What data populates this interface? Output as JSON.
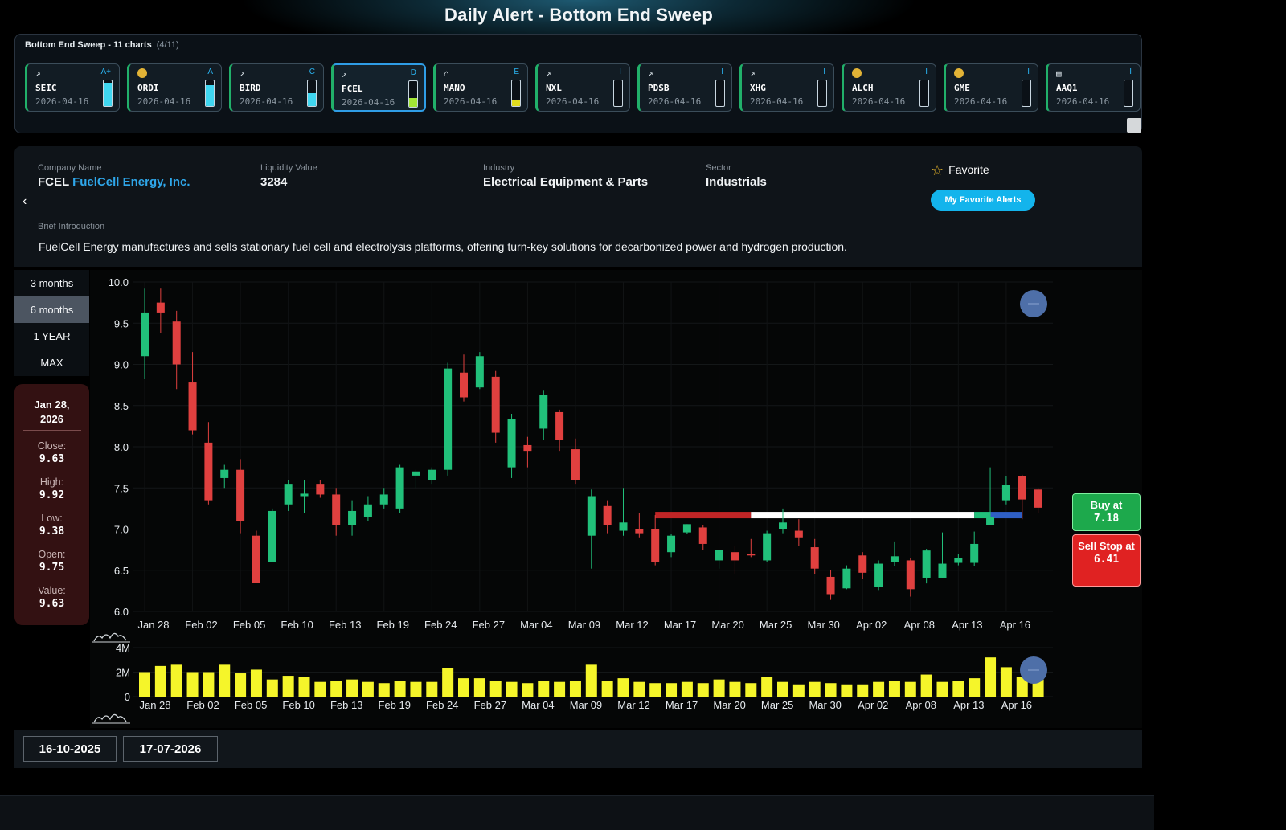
{
  "page": {
    "title": "Daily Alert - Bottom End Sweep"
  },
  "carousel": {
    "title": "Bottom End Sweep - 11 charts",
    "count": "(4/11)",
    "items": [
      {
        "symbol": "SEIC",
        "date": "2026-04-16",
        "grade": "A+",
        "icon": "chart-icon",
        "level": 0.9,
        "fill_color": "#3fd6f0",
        "active": false
      },
      {
        "symbol": "ORDI",
        "date": "2026-04-16",
        "grade": "A",
        "icon": "coin-icon",
        "level": 0.8,
        "fill_color": "#3fd6f0",
        "active": false
      },
      {
        "symbol": "BIRD",
        "date": "2026-04-16",
        "grade": "C",
        "icon": "chart-icon",
        "level": 0.5,
        "fill_color": "#3fd6f0",
        "active": false
      },
      {
        "symbol": "FCEL",
        "date": "2026-04-16",
        "grade": "D",
        "icon": "chart-icon",
        "level": 0.35,
        "fill_color": "#a3e635",
        "active": true
      },
      {
        "symbol": "MANO",
        "date": "2026-04-16",
        "grade": "E",
        "icon": "bank-icon",
        "level": 0.25,
        "fill_color": "#e0dc1e",
        "active": false
      },
      {
        "symbol": "NXL",
        "date": "2026-04-16",
        "grade": "I",
        "icon": "chart-icon",
        "level": 0.0,
        "fill_color": "#3fd6f0",
        "active": false
      },
      {
        "symbol": "PDSB",
        "date": "2026-04-16",
        "grade": "I",
        "icon": "chart-icon",
        "level": 0.0,
        "fill_color": "#3fd6f0",
        "active": false
      },
      {
        "symbol": "XHG",
        "date": "2026-04-16",
        "grade": "I",
        "icon": "chart-icon",
        "level": 0.0,
        "fill_color": "#3fd6f0",
        "active": false
      },
      {
        "symbol": "ALCH",
        "date": "2026-04-16",
        "grade": "I",
        "icon": "coin-icon",
        "level": 0.0,
        "fill_color": "#3fd6f0",
        "active": false
      },
      {
        "symbol": "GME",
        "date": "2026-04-16",
        "grade": "I",
        "icon": "coin-icon",
        "level": 0.0,
        "fill_color": "#3fd6f0",
        "active": false
      },
      {
        "symbol": "AAQ1",
        "date": "2026-04-16",
        "grade": "I",
        "icon": "etf-icon",
        "level": 0.0,
        "fill_color": "#3fd6f0",
        "active": false
      }
    ]
  },
  "info": {
    "company_label": "Company Name",
    "ticker": "FCEL",
    "company_name": "FuelCell Energy, Inc.",
    "liquidity_label": "Liquidity Value",
    "liquidity": "3284",
    "industry_label": "Industry",
    "industry": "Electrical Equipment & Parts",
    "sector_label": "Sector",
    "sector": "Industrials",
    "favorite_label": "Favorite",
    "favorite_alerts_button": "My Favorite Alerts",
    "intro_label": "Brief Introduction",
    "intro": "FuelCell Energy manufactures and sells stationary fuel cell and electrolysis platforms, offering turn-key solutions for decarbonized power and hydrogen production."
  },
  "ranges": [
    "3 months",
    "6 months",
    "1 YEAR",
    "MAX"
  ],
  "active_range": "6 months",
  "ohlc": {
    "date": "Jan 28, 2026",
    "close_label": "Close:",
    "close": "9.63",
    "high_label": "High:",
    "high": "9.92",
    "low_label": "Low:",
    "low": "9.38",
    "open_label": "Open:",
    "open": "9.75",
    "value_label": "Value:",
    "value": "9.63"
  },
  "signals": {
    "buy_label": "Buy at",
    "buy_value": "7.18",
    "sell_label": "Sell Stop at",
    "sell_value": "6.41"
  },
  "date_range": {
    "start": "16-10-2025",
    "end": "17-07-2026"
  },
  "colors": {
    "up": "#21c07a",
    "down": "#e0403f",
    "volume": "#f5f52a",
    "zone_red": "#c02526",
    "zone_white": "#ffffff",
    "zone_blue": "#2f5fc4",
    "accent": "#13b4ec"
  },
  "chart_data": {
    "type": "candlestick",
    "ylim": [
      6.0,
      10.0
    ],
    "y_ticks": [
      "10.0",
      "9.5",
      "9.0",
      "8.5",
      "8.0",
      "7.5",
      "7.0",
      "6.5",
      "6.0"
    ],
    "x_tick_labels": [
      "Jan 28",
      "Feb 02",
      "Feb 05",
      "Feb 10",
      "Feb 13",
      "Feb 19",
      "Feb 24",
      "Feb 27",
      "Mar 04",
      "Mar 09",
      "Mar 12",
      "Mar 17",
      "Mar 20",
      "Mar 25",
      "Mar 30",
      "Apr 02",
      "Apr 08",
      "Apr 13",
      "Apr 16"
    ],
    "candles": [
      {
        "o": 9.1,
        "c": 9.63,
        "h": 9.92,
        "l": 8.82
      },
      {
        "o": 9.75,
        "c": 9.63,
        "h": 9.92,
        "l": 9.38
      },
      {
        "o": 9.52,
        "c": 9.0,
        "h": 9.65,
        "l": 8.7
      },
      {
        "o": 8.78,
        "c": 8.2,
        "h": 9.15,
        "l": 8.15
      },
      {
        "o": 8.05,
        "c": 7.35,
        "h": 8.3,
        "l": 7.3
      },
      {
        "o": 7.62,
        "c": 7.72,
        "h": 7.78,
        "l": 7.5
      },
      {
        "o": 7.72,
        "c": 7.1,
        "h": 7.85,
        "l": 6.95
      },
      {
        "o": 6.92,
        "c": 6.35,
        "h": 6.98,
        "l": 6.35
      },
      {
        "o": 6.6,
        "c": 7.22,
        "h": 7.25,
        "l": 6.6
      },
      {
        "o": 7.3,
        "c": 7.55,
        "h": 7.6,
        "l": 7.22
      },
      {
        "o": 7.4,
        "c": 7.43,
        "h": 7.6,
        "l": 7.2
      },
      {
        "o": 7.55,
        "c": 7.42,
        "h": 7.6,
        "l": 7.38
      },
      {
        "o": 7.42,
        "c": 7.05,
        "h": 7.5,
        "l": 6.92
      },
      {
        "o": 7.05,
        "c": 7.22,
        "h": 7.35,
        "l": 6.92
      },
      {
        "o": 7.15,
        "c": 7.3,
        "h": 7.4,
        "l": 7.1
      },
      {
        "o": 7.3,
        "c": 7.42,
        "h": 7.5,
        "l": 7.25
      },
      {
        "o": 7.25,
        "c": 7.75,
        "h": 7.78,
        "l": 7.2
      },
      {
        "o": 7.65,
        "c": 7.7,
        "h": 7.72,
        "l": 7.5
      },
      {
        "o": 7.6,
        "c": 7.72,
        "h": 7.75,
        "l": 7.55
      },
      {
        "o": 7.72,
        "c": 8.95,
        "h": 9.02,
        "l": 7.65
      },
      {
        "o": 8.9,
        "c": 8.6,
        "h": 9.12,
        "l": 8.55
      },
      {
        "o": 8.72,
        "c": 9.1,
        "h": 9.15,
        "l": 8.7
      },
      {
        "o": 8.85,
        "c": 8.17,
        "h": 8.92,
        "l": 8.05
      },
      {
        "o": 7.75,
        "c": 8.34,
        "h": 8.4,
        "l": 7.62
      },
      {
        "o": 8.02,
        "c": 7.95,
        "h": 8.12,
        "l": 7.75
      },
      {
        "o": 8.22,
        "c": 8.63,
        "h": 8.68,
        "l": 8.08
      },
      {
        "o": 8.42,
        "c": 8.08,
        "h": 8.45,
        "l": 7.95
      },
      {
        "o": 7.97,
        "c": 7.6,
        "h": 8.1,
        "l": 7.55
      },
      {
        "o": 6.92,
        "c": 7.4,
        "h": 7.48,
        "l": 6.52
      },
      {
        "o": 7.28,
        "c": 7.05,
        "h": 7.35,
        "l": 6.95
      },
      {
        "o": 6.98,
        "c": 7.08,
        "h": 7.5,
        "l": 6.92
      },
      {
        "o": 7.0,
        "c": 6.95,
        "h": 7.2,
        "l": 6.9
      },
      {
        "o": 7.0,
        "c": 6.6,
        "h": 7.17,
        "l": 6.56
      },
      {
        "o": 6.72,
        "c": 6.92,
        "h": 6.94,
        "l": 6.66
      },
      {
        "o": 6.96,
        "c": 7.06,
        "h": 7.06,
        "l": 6.94
      },
      {
        "o": 7.02,
        "c": 6.82,
        "h": 7.05,
        "l": 6.75
      },
      {
        "o": 6.62,
        "c": 6.75,
        "h": 6.75,
        "l": 6.52
      },
      {
        "o": 6.72,
        "c": 6.62,
        "h": 6.8,
        "l": 6.46
      },
      {
        "o": 6.7,
        "c": 6.68,
        "h": 6.88,
        "l": 6.66
      },
      {
        "o": 6.62,
        "c": 6.95,
        "h": 6.98,
        "l": 6.6
      },
      {
        "o": 7.0,
        "c": 7.08,
        "h": 7.25,
        "l": 6.95
      },
      {
        "o": 6.98,
        "c": 6.9,
        "h": 7.12,
        "l": 6.8
      },
      {
        "o": 6.78,
        "c": 6.52,
        "h": 6.88,
        "l": 6.45
      },
      {
        "o": 6.42,
        "c": 6.21,
        "h": 6.5,
        "l": 6.14
      },
      {
        "o": 6.28,
        "c": 6.52,
        "h": 6.56,
        "l": 6.27
      },
      {
        "o": 6.68,
        "c": 6.47,
        "h": 6.72,
        "l": 6.4
      },
      {
        "o": 6.3,
        "c": 6.58,
        "h": 6.62,
        "l": 6.26
      },
      {
        "o": 6.6,
        "c": 6.67,
        "h": 6.85,
        "l": 6.55
      },
      {
        "o": 6.62,
        "c": 6.27,
        "h": 6.65,
        "l": 6.18
      },
      {
        "o": 6.41,
        "c": 6.74,
        "h": 6.76,
        "l": 6.34
      },
      {
        "o": 6.41,
        "c": 6.58,
        "h": 6.96,
        "l": 6.41
      },
      {
        "o": 6.59,
        "c": 6.65,
        "h": 6.7,
        "l": 6.56
      },
      {
        "o": 6.59,
        "c": 6.82,
        "h": 6.97,
        "l": 6.55
      },
      {
        "o": 7.05,
        "c": 7.15,
        "h": 7.75,
        "l": 7.05
      },
      {
        "o": 7.35,
        "c": 7.54,
        "h": 7.64,
        "l": 7.3
      },
      {
        "o": 7.64,
        "c": 7.36,
        "h": 7.66,
        "l": 7.12
      },
      {
        "o": 7.48,
        "c": 7.26,
        "h": 7.5,
        "l": 7.2
      }
    ],
    "volume_ylim": [
      0,
      4000000
    ],
    "volume_ticks": [
      "4M",
      "2M",
      "0"
    ],
    "volume": [
      2000000,
      2500000,
      2600000,
      2000000,
      2000000,
      2600000,
      1900000,
      2200000,
      1400000,
      1700000,
      1600000,
      1200000,
      1300000,
      1400000,
      1200000,
      1100000,
      1300000,
      1200000,
      1200000,
      2300000,
      1500000,
      1500000,
      1300000,
      1200000,
      1100000,
      1300000,
      1200000,
      1300000,
      2600000,
      1300000,
      1500000,
      1200000,
      1100000,
      1100000,
      1200000,
      1100000,
      1400000,
      1200000,
      1100000,
      1600000,
      1200000,
      1000000,
      1200000,
      1100000,
      1000000,
      1000000,
      1200000,
      1300000,
      1200000,
      1800000,
      1200000,
      1300000,
      1500000,
      3200000,
      2400000,
      1600000,
      1400000
    ],
    "zones": [
      {
        "color": "red",
        "from_index": 32,
        "to_index": 38,
        "price": 7.17
      },
      {
        "color": "white",
        "from_index": 38,
        "to_index": 52,
        "price": 7.17
      },
      {
        "color": "green",
        "from_index": 52,
        "to_index": 53,
        "price": 7.17
      },
      {
        "color": "blue",
        "from_index": 53,
        "to_index": 55,
        "price": 7.17
      }
    ]
  }
}
